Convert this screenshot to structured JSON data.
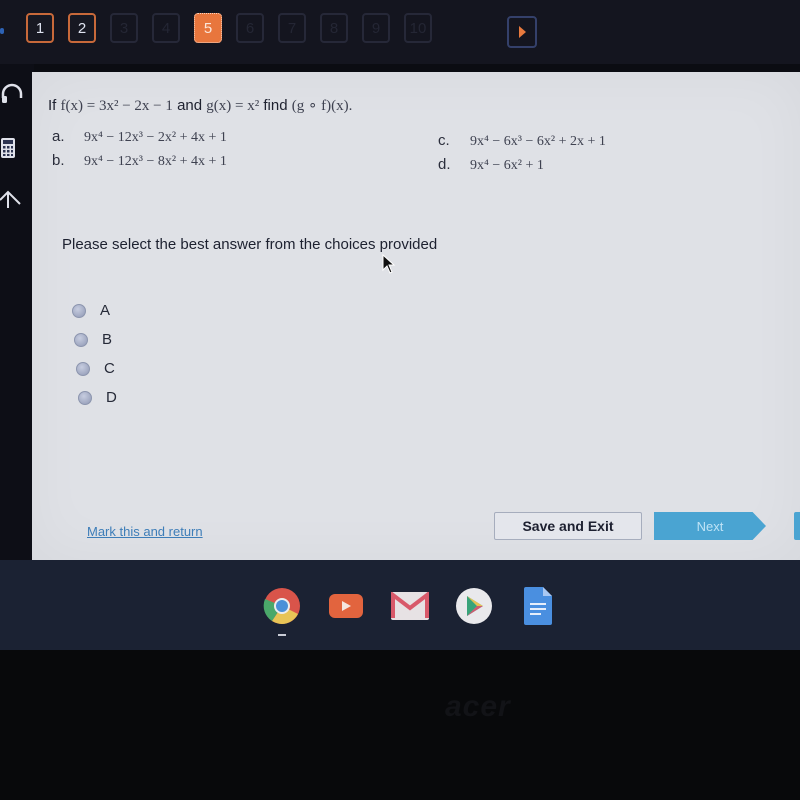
{
  "nav": {
    "questions": [
      {
        "label": "1",
        "state": "answered"
      },
      {
        "label": "2",
        "state": "answered"
      },
      {
        "label": "3",
        "state": "unvisited"
      },
      {
        "label": "4",
        "state": "unvisited"
      },
      {
        "label": "5",
        "state": "current"
      },
      {
        "label": "6",
        "state": "unvisited"
      },
      {
        "label": "7",
        "state": "unvisited"
      },
      {
        "label": "8",
        "state": "unvisited"
      },
      {
        "label": "9",
        "state": "unvisited"
      },
      {
        "label": "10",
        "state": "unvisited"
      }
    ],
    "next_icon": "play-triangle-icon"
  },
  "rail": {
    "icons": [
      "headphones-icon",
      "calculator-icon",
      "pointer-tool-icon"
    ]
  },
  "question": {
    "if": "If",
    "f_expr": "f(x) = 3x² − 2x − 1",
    "and": "and",
    "g_expr": "g(x) = x²",
    "find": "find",
    "target": "(g ∘ f)(x)."
  },
  "choices": [
    {
      "letter": "a.",
      "expr": "9x⁴ − 12x³ − 2x² + 4x + 1"
    },
    {
      "letter": "b.",
      "expr": "9x⁴ − 12x³ − 8x² + 4x + 1"
    },
    {
      "letter": "c.",
      "expr": "9x⁴ − 6x³ − 6x² + 2x + 1"
    },
    {
      "letter": "d.",
      "expr": "9x⁴ − 6x² + 1"
    }
  ],
  "prompt": "Please select the best answer from the choices provided",
  "options": [
    "A",
    "B",
    "C",
    "D"
  ],
  "footer": {
    "mark_link": "Mark this and return",
    "save_exit": "Save and Exit",
    "next": "Next"
  },
  "shelf": {
    "apps": [
      "chrome-icon",
      "youtube-icon",
      "gmail-icon",
      "play-store-icon",
      "docs-icon"
    ]
  },
  "device_brand": "acer",
  "colors": {
    "accent_orange": "#e8763d",
    "next_blue": "#4aa4d2",
    "link_blue": "#3d7db8"
  }
}
